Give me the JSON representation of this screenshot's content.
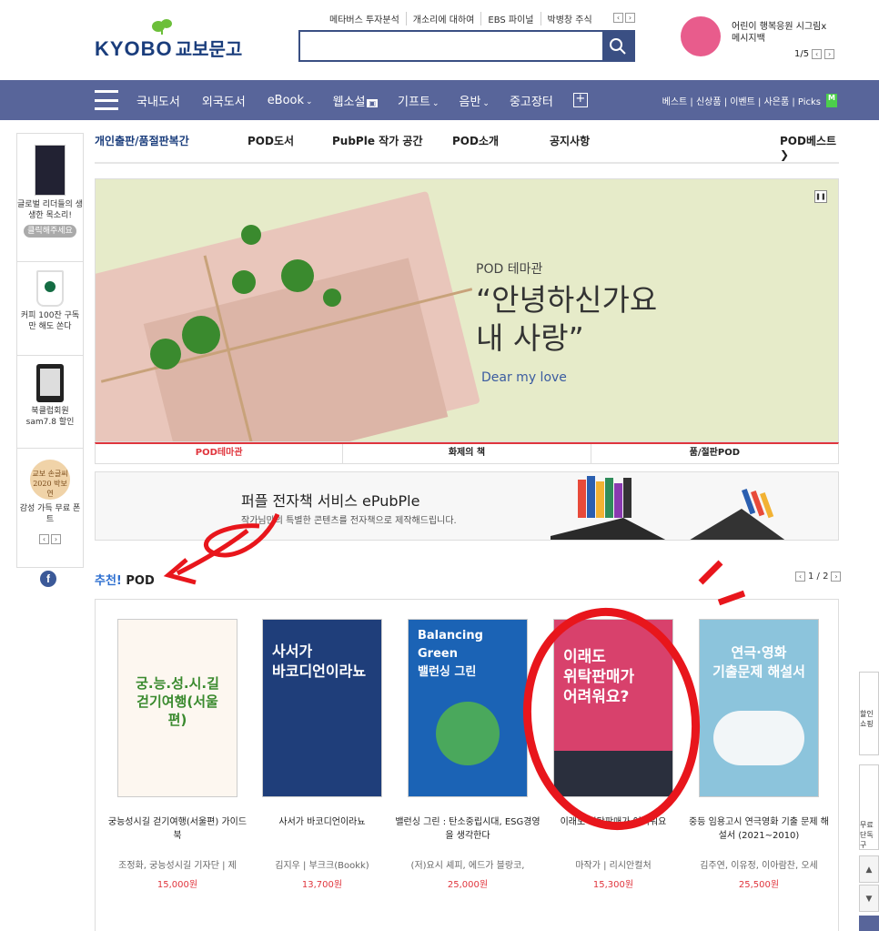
{
  "header": {
    "logo_word": "KYOBO",
    "logo_ko": "교보문고",
    "top_links": [
      "메타버스 투자분석",
      "개소리에 대하여",
      "EBS 파이널",
      "박병창 주식"
    ],
    "search_placeholder": "",
    "promo_text": "어린이 행복응원 시그림x메시지백",
    "promo_page": "1/5"
  },
  "nav": {
    "items": [
      {
        "label": "국내도서",
        "caret": ""
      },
      {
        "label": "외국도서",
        "caret": ""
      },
      {
        "label": "eBook",
        "caret": "⌄"
      },
      {
        "label": "웹소설",
        "caret": ""
      },
      {
        "label": "기프트",
        "caret": "⌄"
      },
      {
        "label": "음반",
        "caret": "⌄"
      },
      {
        "label": "중고장터",
        "caret": ""
      }
    ],
    "right_links": "베스트 | 신상품 | 이벤트 | 사은품 | Picks",
    "picks_badge": "M"
  },
  "subnav": {
    "items": [
      "개인출판/품절판복간",
      "POD도서",
      "PubPle 작가 공간",
      "POD소개",
      "공지사항",
      "POD베스트 ❯"
    ]
  },
  "sidebar": {
    "item1": "글로벌 리더들의 생생한 목소리!",
    "item1_btn": "클릭해주세요",
    "item2": "커피 100잔 구독만 해도 쏜다",
    "item3": "북클럽회원 sam7.8 할인",
    "item4_badge": "교보 손글씨 2020 박보연",
    "item4": "감성 가득 무료 폰트",
    "facebook": "f"
  },
  "banner": {
    "sub": "POD 테마관",
    "title_line1": "“안녕하신가요",
    "title_line2": "내 사랑”",
    "english": "Dear my love"
  },
  "tabs": [
    "POD테마관",
    "화제의 책",
    "품/절판POD"
  ],
  "pubple": {
    "title": "퍼플 전자책 서비스 ePubPle",
    "sub": "작가님만의 특별한 콘텐츠를 전자책으로 제작해드립니다."
  },
  "recommend": {
    "title_prefix": "추천!",
    "title_main": "POD",
    "page": "1 / 2",
    "books": [
      {
        "cover_text": "궁.능.성.시.길\n걷기여행(서울편)",
        "title": "궁능성시길 걷기여행(서울편) 가이드북",
        "author": "조정화, 궁능성시길 기자단 | 제",
        "price": "15,000원",
        "cover_color": "#fdf7f0"
      },
      {
        "cover_text": "사서가\n바코디언이라뇨",
        "title": "사서가 바코디언이라뇨",
        "author": "김지우 | 부크크(Bookk)",
        "price": "13,700원",
        "cover_color": "#1f3e7a"
      },
      {
        "cover_text": "Balancing Green\n밸런싱 그린",
        "title": "밸런싱 그린 : 탄소중립시대, ESG경영을 생각한다",
        "author": "(저)요시 셰피, 에드가 블랑코,",
        "price": "25,000원",
        "cover_color": "#1b63b5"
      },
      {
        "cover_text": "이래도\n위탁판매가\n어려워요?",
        "title": "이래도 위탁판매가 어려워요",
        "author": "마작가 | 리시안컬처",
        "price": "15,300원",
        "cover_color": "#d8416c"
      },
      {
        "cover_text": "연극·영화\n기출문제 해설서",
        "title": "중등 임용고시 연극영화 기출 문제 해설서 (2021~2010)",
        "author": "김주연, 이유정, 이아람찬, 오세",
        "price": "25,500원",
        "cover_color": "#8cc4dc"
      }
    ]
  },
  "floater": {
    "item1": "할인 쇼핑",
    "item2": "무료 단독구"
  }
}
